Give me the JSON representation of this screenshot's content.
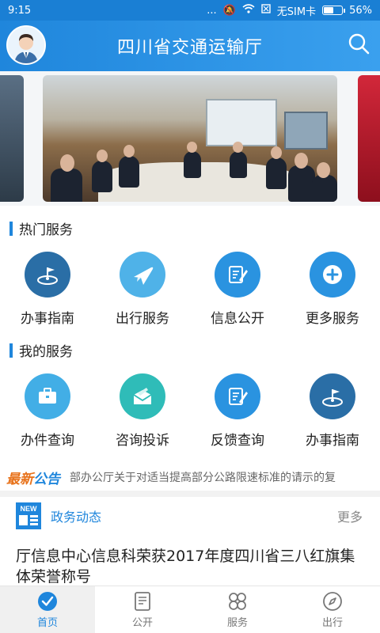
{
  "status_bar": {
    "time": "9:15",
    "dots": "...",
    "sim": "无SIM卡",
    "battery": "56%",
    "battery_level": 0.56
  },
  "header": {
    "title": "四川省交通运输厅",
    "avatar_icon": "user-avatar-icon",
    "search_icon": "search-icon"
  },
  "hot_services": {
    "heading": "热门服务",
    "items": [
      {
        "label": "办事指南",
        "icon": "guide-icon",
        "color": "#2a6ea6"
      },
      {
        "label": "出行服务",
        "icon": "plane-icon",
        "color": "#4fb2e8"
      },
      {
        "label": "信息公开",
        "icon": "edit-doc-icon",
        "color": "#2a93e0"
      },
      {
        "label": "更多服务",
        "icon": "plus-icon",
        "color": "#2a93e0"
      }
    ]
  },
  "my_services": {
    "heading": "我的服务",
    "items": [
      {
        "label": "办件查询",
        "icon": "briefcase-icon",
        "color": "#42aee6"
      },
      {
        "label": "咨询投诉",
        "icon": "envelope-icon",
        "color": "#2fbcb8"
      },
      {
        "label": "反馈查询",
        "icon": "edit-doc-icon",
        "color": "#2a93e0"
      },
      {
        "label": "办事指南",
        "icon": "guide-icon",
        "color": "#2a6ea6"
      }
    ]
  },
  "notice": {
    "tag_part1": "最新",
    "tag_part2": "公告",
    "text": "部办公厅关于对适当提高部分公路限速标准的请示的复"
  },
  "news": {
    "title": "政务动态",
    "more": "更多",
    "icon_label": "NEW",
    "headline": "厅信息中心信息科荣获2017年度四川省三八红旗集体荣誉称号"
  },
  "bottom_nav": {
    "items": [
      {
        "label": "首页",
        "icon": "home-check-icon",
        "active": true
      },
      {
        "label": "公开",
        "icon": "document-icon",
        "active": false
      },
      {
        "label": "服务",
        "icon": "services-grid-icon",
        "active": false
      },
      {
        "label": "出行",
        "icon": "compass-icon",
        "active": false
      }
    ]
  },
  "colors": {
    "brand": "#1f86dc",
    "notice_accent": "#e8731c"
  }
}
